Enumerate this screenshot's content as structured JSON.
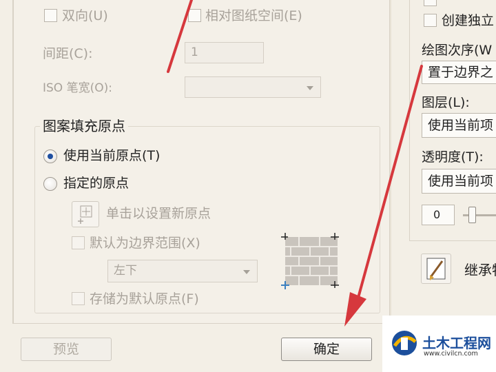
{
  "left": {
    "bidirectional": {
      "label": "双向(U)",
      "checked": false
    },
    "relative_paper_space": {
      "label": "相对图纸空间(E)",
      "checked": false
    },
    "spacing": {
      "label": "间距(C):",
      "value": "1"
    },
    "iso_pen_width": {
      "label": "ISO 笔宽(O):",
      "value": ""
    },
    "hatch_origin": {
      "title": "图案填充原点",
      "use_current": {
        "label": "使用当前原点(T)",
        "checked": true
      },
      "specified": {
        "label": "指定的原点",
        "checked": false
      },
      "click_set": {
        "label": "单击以设置新原点"
      },
      "default_extents": {
        "label": "默认为边界范围(X)",
        "checked": false
      },
      "position": {
        "value": "左下"
      },
      "store_default": {
        "label": "存储为默认原点(F)",
        "checked": false
      }
    },
    "preview_button": "预览",
    "ok_button": "确定"
  },
  "right": {
    "create_separate": {
      "label": "创建独立",
      "checked": false
    },
    "draw_order": {
      "label": "绘图次序(W",
      "value": "置于边界之"
    },
    "layer": {
      "label": "图层(L):",
      "value": "使用当前项"
    },
    "transparency": {
      "label": "透明度(T):",
      "value": "使用当前项"
    },
    "transparency_value": "0",
    "inherit_label": "继承特"
  },
  "watermark": {
    "title": "土木工程网",
    "url": "www.civilcn.com"
  },
  "colors": {
    "arrow": "#d6383d",
    "radio_dot": "#1f4fa0",
    "brand_blue": "#1c4f9c"
  }
}
